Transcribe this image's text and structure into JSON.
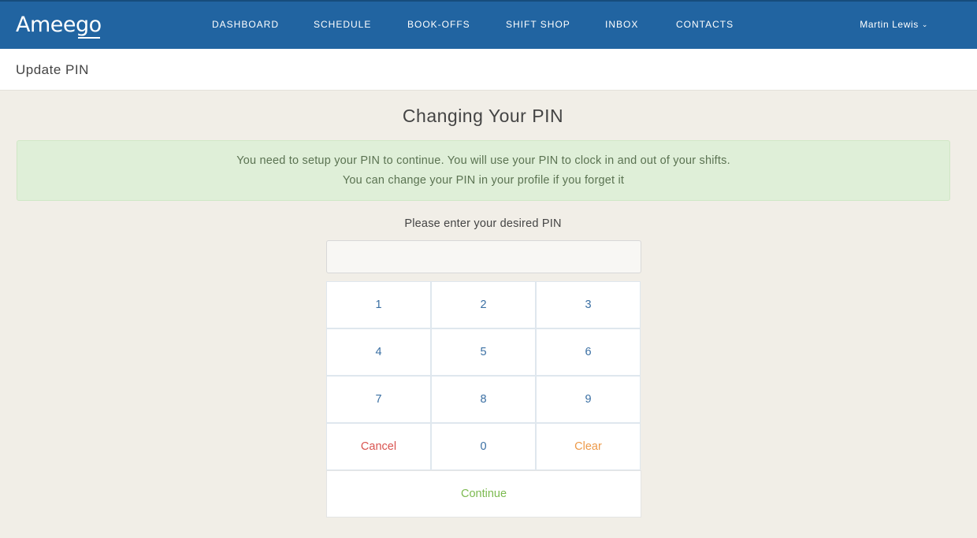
{
  "app": {
    "brand": "Ameego"
  },
  "nav": {
    "items": [
      {
        "label": "DASHBOARD"
      },
      {
        "label": "SCHEDULE"
      },
      {
        "label": "BOOK-OFFS"
      },
      {
        "label": "SHIFT SHOP"
      },
      {
        "label": "INBOX"
      },
      {
        "label": "CONTACTS"
      }
    ],
    "user": {
      "name": "Martin Lewis",
      "icon": "chevron-down-icon"
    }
  },
  "subheader": {
    "title": "Update PIN"
  },
  "main": {
    "heading": "Changing Your PIN",
    "alert": {
      "line1": "You need to setup your PIN to continue. You will use your PIN to clock in and out of your shifts.",
      "line2": "You can change your PIN in your profile if you forget it"
    },
    "prompt": "Please enter your desired PIN",
    "pin_value": "",
    "keypad": {
      "keys": [
        "1",
        "2",
        "3",
        "4",
        "5",
        "6",
        "7",
        "8",
        "9",
        "Cancel",
        "0",
        "Clear"
      ],
      "continue_label": "Continue"
    }
  },
  "colors": {
    "navbar": "#2164a1",
    "background": "#f1eee7",
    "alert_bg": "#dfefd8",
    "key_text": "#3a6fa3",
    "cancel": "#d9534f",
    "clear": "#ed9a4a",
    "continue": "#7cba50"
  }
}
